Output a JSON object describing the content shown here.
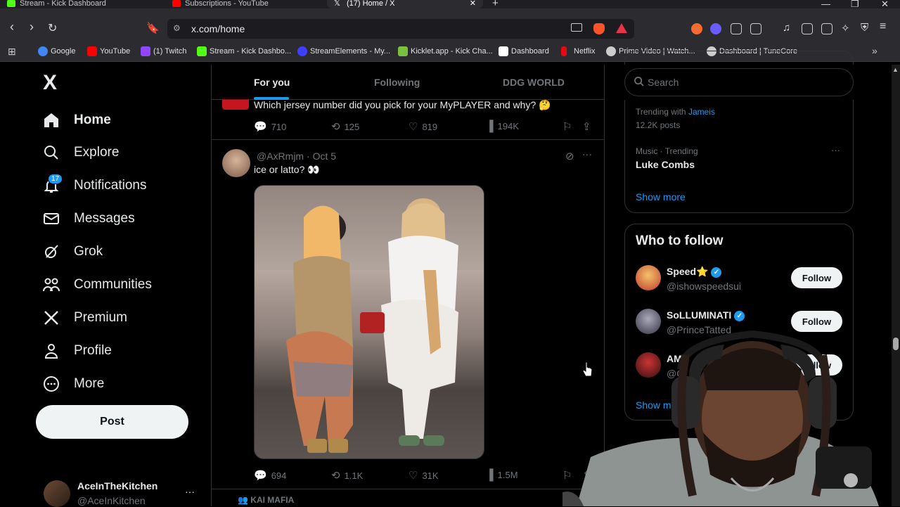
{
  "browser": {
    "tabs": [
      {
        "label": "Stream - Kick Dashboard",
        "color": "#53fc18"
      },
      {
        "label": "Subscriptions - YouTube",
        "color": "#ff0000"
      },
      {
        "label": "(17) Home / X",
        "color": "#ffffff"
      }
    ],
    "new_tab": "+",
    "url": "x.com/home",
    "bookmarks": [
      {
        "label": "Google",
        "color": "#4285f4"
      },
      {
        "label": "YouTube",
        "color": "#ff0000"
      },
      {
        "label": "(1) Twitch",
        "color": "#9146ff"
      },
      {
        "label": "Stream - Kick Dashbo...",
        "color": "#53fc18"
      },
      {
        "label": "StreamElements - My...",
        "color": "#3f3fff"
      },
      {
        "label": "Kicklet.app - Kick Cha...",
        "color": "#7ac142"
      },
      {
        "label": "Dashboard",
        "color": "#ffffff"
      },
      {
        "label": "Netflix",
        "color": "#e50914"
      },
      {
        "label": "Prime Video | Watch...",
        "color": "#cccccc"
      },
      {
        "label": "Dashboard | TuneCore",
        "color": "#cccccc"
      }
    ]
  },
  "nav": {
    "logo": "X",
    "items": [
      {
        "label": "Home",
        "icon": "home-icon"
      },
      {
        "label": "Explore",
        "icon": "search-icon"
      },
      {
        "label": "Notifications",
        "icon": "bell-icon"
      },
      {
        "label": "Messages",
        "icon": "mail-icon"
      },
      {
        "label": "Grok",
        "icon": "grok-icon"
      },
      {
        "label": "Communities",
        "icon": "communities-icon"
      },
      {
        "label": "Premium",
        "icon": "x-premium-icon"
      },
      {
        "label": "Profile",
        "icon": "person-icon"
      },
      {
        "label": "More",
        "icon": "more-circle-icon"
      }
    ],
    "notification_badge": "17",
    "post_label": "Post",
    "account": {
      "name": "AceInTheKitchen",
      "handle": "@AceInKitchen",
      "more": "···"
    }
  },
  "feed": {
    "tabs": [
      "For you",
      "Following",
      "DDG WORLD"
    ],
    "tweet1": {
      "text": "Which jersey number did you pick for your MyPLAYER and why? 🤔",
      "replies": "710",
      "reposts": "125",
      "likes": "819",
      "views": "194K"
    },
    "tweet2": {
      "handle": "@AxRmjm",
      "dot": "·",
      "date": "Oct 5",
      "text": "ice or latto? 👀",
      "replies": "694",
      "reposts": "1.1K",
      "likes": "31K",
      "views": "1.5M"
    },
    "tweet3_label": "KAI MAFIA"
  },
  "sidebar": {
    "search_placeholder": "Search",
    "trend1_sub": "Trending with",
    "trend1_link": "Jameis",
    "trend1_posts": "12.2K posts",
    "trend2_category": "Music · Trending",
    "trend2_name": "Luke Combs",
    "show_more": "Show more",
    "who_to_follow_title": "Who to follow",
    "follow_label": "Follow",
    "accounts": [
      {
        "name": "Speed⭐",
        "handle": "@ishowspeedsui"
      },
      {
        "name": "SoLLUMINATI",
        "handle": "@PrinceTatted"
      },
      {
        "name": "AMP",
        "handle": "@C"
      }
    ],
    "show_more2": "Show m"
  }
}
